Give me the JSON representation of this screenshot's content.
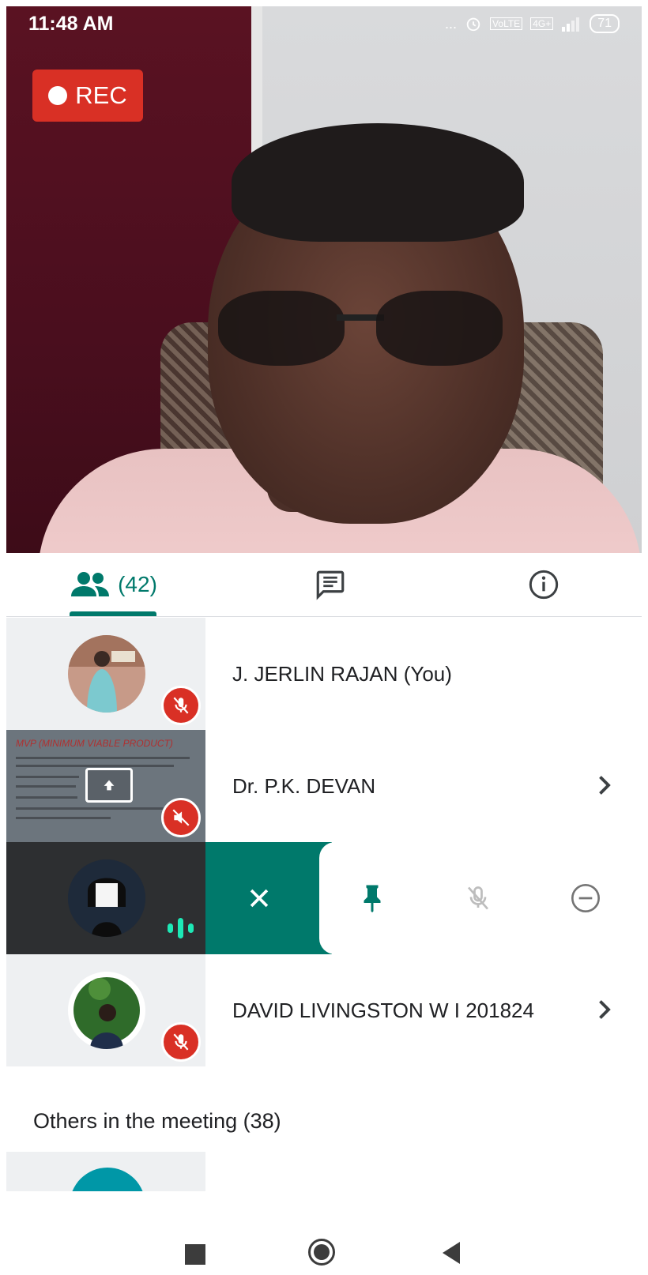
{
  "status_bar": {
    "time": "11:48 AM",
    "dots": "...",
    "volte": "VoLTE",
    "network": "4G+",
    "battery": "71"
  },
  "video": {
    "rec_label": "REC"
  },
  "tabs": {
    "people_count": "(42)",
    "active_color": "#00796b"
  },
  "participants": [
    {
      "name": "J. JERLIN RAJAN (You)",
      "muted": true
    },
    {
      "name": "Dr. P.K. DEVAN",
      "muted": true,
      "presenting": true,
      "slide_title": "MVP (MINIMUM VIABLE PRODUCT)"
    },
    {
      "speaking": true,
      "actions": [
        "close",
        "pin",
        "mute",
        "remove"
      ]
    },
    {
      "name": "DAVID LIVINGSTON W I 201824",
      "muted": true
    }
  ],
  "others_heading": "Others in the meeting (38)",
  "colors": {
    "accent": "#00796b",
    "mute_red": "#d93025",
    "speaking": "#1de9b6"
  }
}
